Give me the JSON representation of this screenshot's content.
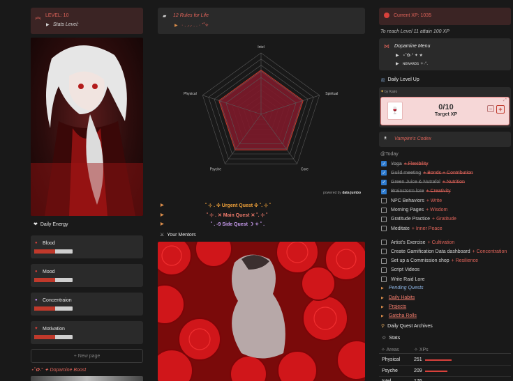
{
  "level": {
    "title": "LEVEL: 10",
    "stats_label": "Stats Level:"
  },
  "energy": {
    "title": "Daily Energy",
    "items": [
      {
        "label": "Blood",
        "fill": 0.55
      },
      {
        "label": "Mood",
        "fill": 0.55
      },
      {
        "label": "Concentraion",
        "fill": 0.55
      },
      {
        "label": "Motivation",
        "fill": 0.55
      }
    ],
    "new_page": "+ New page",
    "boost": "⋆˚✿˖° ✦ Dopamine Boost"
  },
  "rules": {
    "title": "12 Rules for Life",
    "sub": "· . ⸝⸝ . . · ⁺˚⟡"
  },
  "radar": {
    "axes": [
      "Intel",
      "Spiritual",
      "Core",
      "Psyche",
      "Physical"
    ],
    "values": [
      0.72,
      0.72,
      0.72,
      0.72,
      0.72
    ],
    "powered_prefix": "powered by",
    "powered_brand": "data jumbo"
  },
  "quests": [
    {
      "text": "˚ ⊹ . ✣ Urgent Quest ✣ ˚. ⊹ ˚",
      "color": "#f2a33a"
    },
    {
      "text": "˚ ⊹ . ✕ Main Quest ✕ ˚. ⊹ ˚",
      "color": "#f07b6b"
    },
    {
      "text": "˚ . -9 Side Quest ☽ ✧ ˚ .",
      "color": "#c99cf0"
    }
  ],
  "mentors": {
    "title": "Your Mentors"
  },
  "xp": {
    "current": "Current XP: 1035",
    "reach": "To reach Level 11 attain 100 XP"
  },
  "dopamine_menu": {
    "title": "Dopamine Menu",
    "items": [
      "⋆˚✿˖° ✦ ★",
      "ɴᴇᴡᴀʀᴅꜱ ✧˖°."
    ]
  },
  "daily_level_up": {
    "title": "Daily Level Up",
    "by": "by Kairo",
    "counter": "0/10",
    "target": "Target XP",
    "minus": "−",
    "plus": "+"
  },
  "vampire": {
    "title": "Vampire's Codex"
  },
  "today": {
    "label": "@Today",
    "todos": [
      {
        "task": "Yoga",
        "reward": "+ Flexibility",
        "done": true
      },
      {
        "task": "Guild meeting",
        "reward": "+ Bonds + Contribution",
        "done": true
      },
      {
        "task": "Green Juice & Nutrafol",
        "reward": "+ Nutrition",
        "done": true
      },
      {
        "task": "Brainstorm lore",
        "reward": "+ Creativity",
        "done": true
      },
      {
        "task": "NPC Behaviors",
        "reward": "+ Write",
        "done": false
      },
      {
        "task": "Morning Pages",
        "reward": "+ Wisdom",
        "done": false
      },
      {
        "task": "Gratitude Practice",
        "reward": "+ Gratitude",
        "done": false
      },
      {
        "task": "Meditate",
        "reward": "+ Inner Peace",
        "done": false
      }
    ],
    "todos2": [
      {
        "task": "Artist's Exercise",
        "reward": "+ Cultivation",
        "done": false
      },
      {
        "task": "Create Gamification Data dashboard",
        "reward": "+ Concentration",
        "done": false
      },
      {
        "task": "Set up a Commission shop",
        "reward": "+ Resilience",
        "done": false
      },
      {
        "task": "Script Videos",
        "reward": "",
        "done": false
      },
      {
        "task": "Write Raid Lore",
        "reward": "",
        "done": false
      }
    ]
  },
  "toggles": [
    "Pending Quests",
    "Daily Habits",
    "Projects",
    "Gatcha Rolls"
  ],
  "archives": "Daily Quest Archives",
  "stats": {
    "title": "Stats",
    "col_areas": "Areas",
    "col_xps": "XPs",
    "rows": [
      {
        "area": "Physical",
        "xp": "251",
        "fill": 0.65
      },
      {
        "area": "Psyche",
        "xp": "209",
        "fill": 0.55
      },
      {
        "area": "Intel",
        "xp": "176",
        "fill": 0.45
      }
    ]
  },
  "colors": {
    "accent": "#e0645a",
    "bg": "#191919",
    "card": "#2a2a2a",
    "xp_card": "#f6d7d7"
  }
}
